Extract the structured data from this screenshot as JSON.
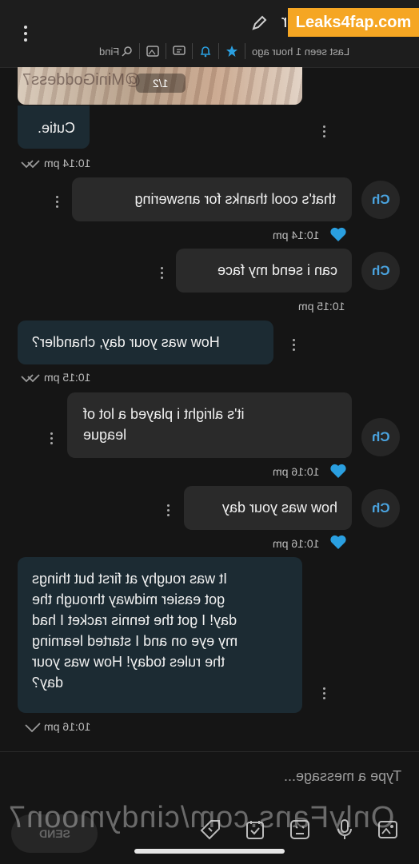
{
  "header": {
    "contact_name": "r",
    "last_seen": "Last seen 1 hour ago",
    "find_label": "Find",
    "watermark_top": "Leaks4fap.com",
    "icons": [
      "search-icon",
      "image-icon",
      "message-icon",
      "bell-icon",
      "star-icon",
      "edit-pencil-icon",
      "menu-icon"
    ]
  },
  "photo": {
    "caption": "1/2",
    "overlay_text": "@MiniGoddess7"
  },
  "messages": [
    {
      "id": "m1",
      "side": "in",
      "text": "Cutie.",
      "time": "10:14 pm"
    },
    {
      "id": "m2",
      "side": "out",
      "avatar": "Ch",
      "text": "that's cool thanks for answering",
      "time": "10:14 pm",
      "liked": true
    },
    {
      "id": "m3",
      "side": "out",
      "avatar": "Ch",
      "text": "can i send my face",
      "time": "10:15 pm",
      "liked": false
    },
    {
      "id": "m4",
      "side": "in",
      "text": "How was your day, chandler?",
      "time": "10:15 pm"
    },
    {
      "id": "m5",
      "side": "out",
      "avatar": "Ch",
      "text_lines": [
        "it's alright i played a lot of",
        "league"
      ],
      "time": "10:16 pm",
      "liked": true
    },
    {
      "id": "m6",
      "side": "out",
      "avatar": "Ch",
      "text": "how was your day",
      "time": "10:16 pm",
      "liked": true
    },
    {
      "id": "m7",
      "side": "in",
      "text_lines": [
        "It was roughy at first but things",
        "got easier midway through the",
        "day! I got the tennis racket I had",
        "my eye on and I started learning",
        "the rules today! How was your",
        "day?"
      ],
      "time": "10:16 pm"
    }
  ],
  "composer": {
    "placeholder": "Type a message...",
    "send_label": "SEND",
    "tools": [
      "attach-image-icon",
      "mic-icon",
      "media-icon",
      "vault-icon",
      "price-tag-icon"
    ]
  },
  "watermark_bottom": "OnlyFans.com/cindymoon7",
  "colors": {
    "background": "#151515",
    "incoming_bubble": "#1c2b33",
    "outgoing_bubble": "#2a2a2a",
    "accent_blue": "#2a9fe0",
    "watermark_orange": "#f5a623"
  }
}
